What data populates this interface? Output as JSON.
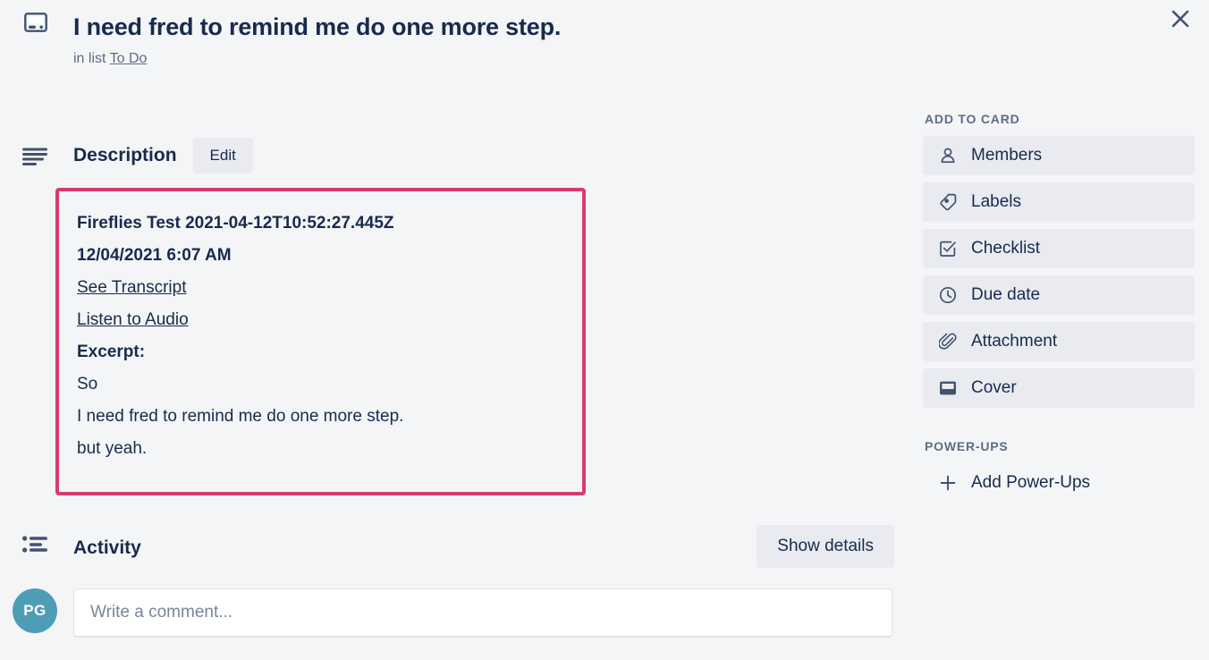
{
  "header": {
    "card_icon": "card-icon",
    "title": "I need fred to remind me do one more step.",
    "in_list_prefix": "in list",
    "list_name": "To Do",
    "close_icon": "close-icon"
  },
  "description": {
    "section_icon": "description-lines-icon",
    "title": "Description",
    "edit_label": "Edit",
    "highlight_color": "#d93b6e",
    "body": {
      "heading": "Fireflies Test 2021-04-12T10:52:27.445Z",
      "subheading": "12/04/2021 6:07 AM",
      "links": [
        "See Transcript",
        "Listen to Audio"
      ],
      "excerpt_label": "Excerpt:",
      "excerpt_lines": [
        "So",
        "I need fred to remind me do one more step.",
        "but yeah."
      ]
    }
  },
  "activity": {
    "section_icon": "activity-list-icon",
    "title": "Activity",
    "show_details_label": "Show details",
    "avatar_initials": "PG",
    "avatar_color": "#4d9eb5",
    "comment_placeholder": "Write a comment..."
  },
  "sidebar": {
    "add_to_card_heading": "ADD TO CARD",
    "items": [
      {
        "label": "Members",
        "icon": "person-icon"
      },
      {
        "label": "Labels",
        "icon": "tag-icon"
      },
      {
        "label": "Checklist",
        "icon": "checkbox-icon"
      },
      {
        "label": "Due date",
        "icon": "clock-icon"
      },
      {
        "label": "Attachment",
        "icon": "paperclip-icon"
      },
      {
        "label": "Cover",
        "icon": "cover-icon"
      }
    ],
    "powerups_heading": "POWER-UPS",
    "add_powerups_label": "Add Power-Ups",
    "add_powerups_icon": "plus-icon"
  }
}
